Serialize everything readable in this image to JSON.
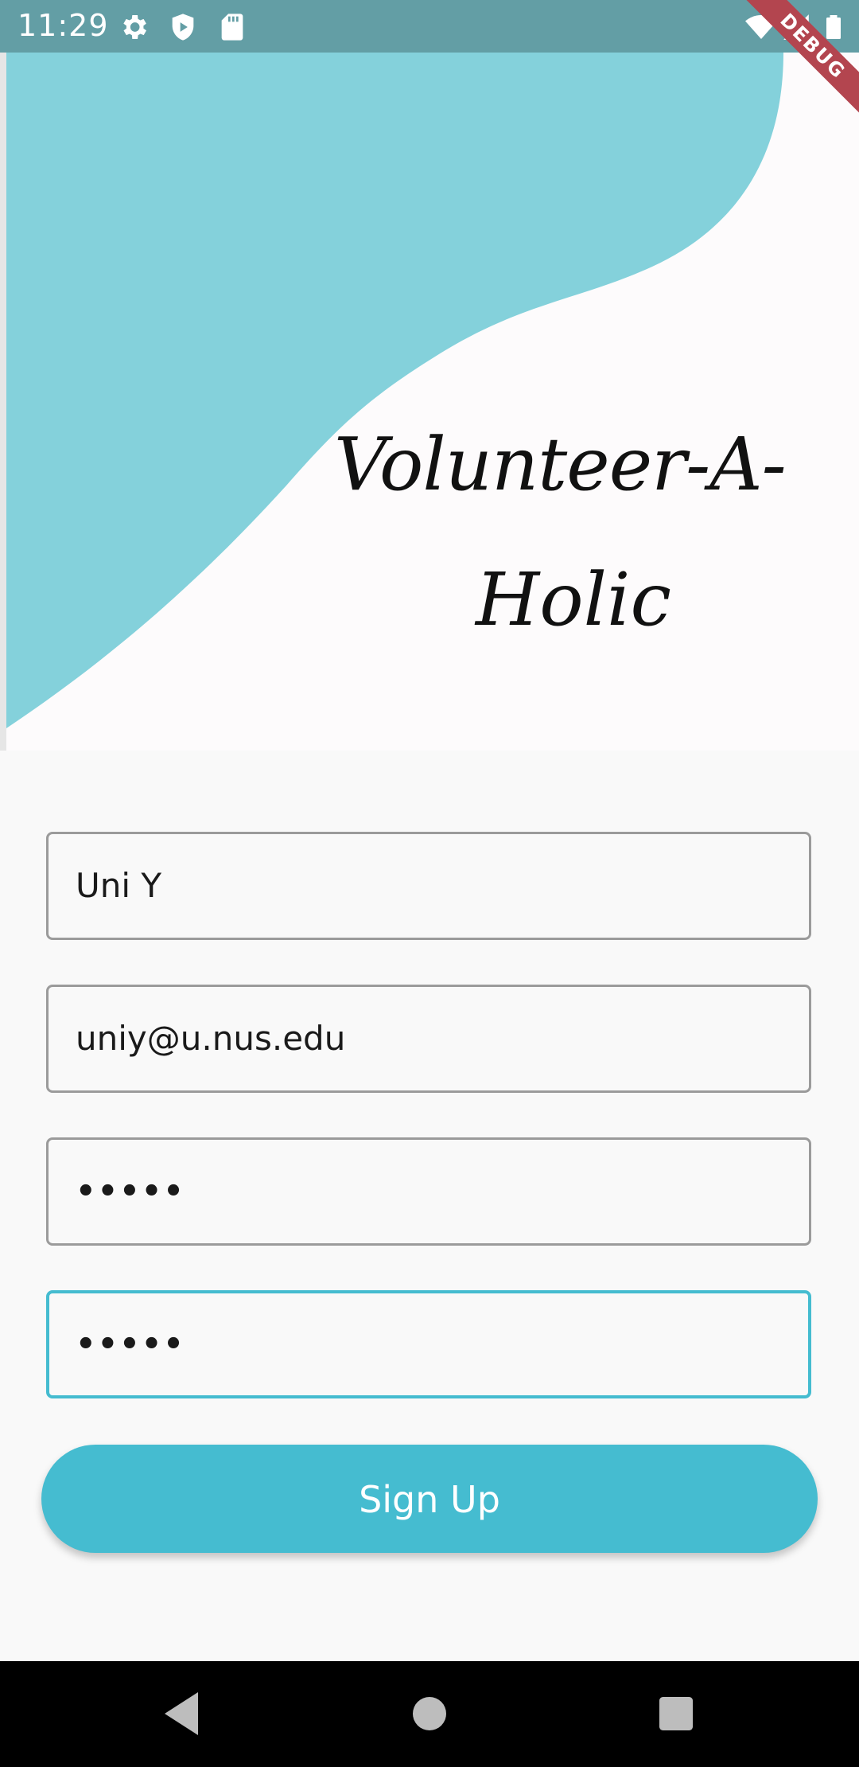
{
  "status_bar": {
    "time": "11:29",
    "icons": [
      "settings-icon",
      "shield-icon",
      "sd-card-icon",
      "wifi-icon",
      "cell-signal-icon",
      "battery-icon"
    ]
  },
  "debug_banner": "DEBUG",
  "header": {
    "brand_line1": "Volunteer-A-",
    "brand_line2": "Holic",
    "blob_color": "#84d1db"
  },
  "form": {
    "name_value": "Uni Y",
    "email_value": "uniy@u.nus.edu",
    "password_value": "•••••",
    "confirm_password_value": "•••••",
    "submit_label": "Sign Up",
    "accent_color": "#45bcd0"
  },
  "nav_bar": {
    "buttons": [
      "back-icon",
      "home-icon",
      "recents-icon"
    ]
  }
}
